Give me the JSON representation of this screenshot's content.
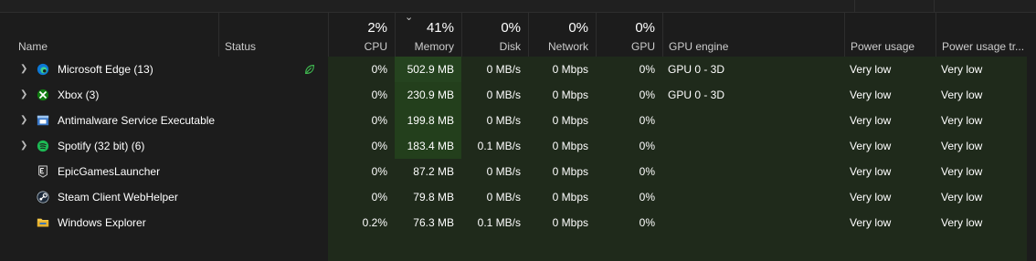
{
  "header": {
    "name_label": "Name",
    "status_label": "Status",
    "cpu": {
      "pct": "2%",
      "label": "CPU"
    },
    "memory": {
      "pct": "41%",
      "label": "Memory",
      "sort_indicator": "chevron-down"
    },
    "disk": {
      "pct": "0%",
      "label": "Disk"
    },
    "network": {
      "pct": "0%",
      "label": "Network"
    },
    "gpu": {
      "pct": "0%",
      "label": "GPU"
    },
    "gpu_engine_label": "GPU engine",
    "power_usage_label": "Power usage",
    "power_trend_label": "Power usage tr..."
  },
  "processes": [
    {
      "name": "Microsoft Edge (13)",
      "icon": "edge-icon",
      "expandable": true,
      "status_icon": "efficiency-leaf-icon",
      "cpu": "0%",
      "memory": "502.9 MB",
      "disk": "0 MB/s",
      "network": "0 Mbps",
      "gpu": "0%",
      "gpu_engine": "GPU 0 - 3D",
      "power": "Very low",
      "power_trend": "Very low"
    },
    {
      "name": "Xbox (3)",
      "icon": "xbox-icon",
      "expandable": true,
      "cpu": "0%",
      "memory": "230.9 MB",
      "disk": "0 MB/s",
      "network": "0 Mbps",
      "gpu": "0%",
      "gpu_engine": "GPU 0 - 3D",
      "power": "Very low",
      "power_trend": "Very low"
    },
    {
      "name": "Antimalware Service Executable",
      "icon": "antimalware-icon",
      "expandable": true,
      "cpu": "0%",
      "memory": "199.8 MB",
      "disk": "0 MB/s",
      "network": "0 Mbps",
      "gpu": "0%",
      "gpu_engine": "",
      "power": "Very low",
      "power_trend": "Very low"
    },
    {
      "name": "Spotify (32 bit) (6)",
      "icon": "spotify-icon",
      "expandable": true,
      "cpu": "0%",
      "memory": "183.4 MB",
      "disk": "0.1 MB/s",
      "network": "0 Mbps",
      "gpu": "0%",
      "gpu_engine": "",
      "power": "Very low",
      "power_trend": "Very low"
    },
    {
      "name": "EpicGamesLauncher",
      "icon": "epic-games-icon",
      "expandable": false,
      "cpu": "0%",
      "memory": "87.2 MB",
      "disk": "0 MB/s",
      "network": "0 Mbps",
      "gpu": "0%",
      "gpu_engine": "",
      "power": "Very low",
      "power_trend": "Very low"
    },
    {
      "name": "Steam Client WebHelper",
      "icon": "steam-icon",
      "expandable": false,
      "cpu": "0%",
      "memory": "79.8 MB",
      "disk": "0 MB/s",
      "network": "0 Mbps",
      "gpu": "0%",
      "gpu_engine": "",
      "power": "Very low",
      "power_trend": "Very low"
    },
    {
      "name": "Windows Explorer",
      "icon": "folder-icon",
      "expandable": false,
      "cpu": "0.2%",
      "memory": "76.3 MB",
      "disk": "0.1 MB/s",
      "network": "0 Mbps",
      "gpu": "0%",
      "gpu_engine": "",
      "power": "Very low",
      "power_trend": "Very low"
    }
  ],
  "colors": {
    "background": "#1c1c1c",
    "heat_low": "#1f2a1b",
    "heat_mid": "#233f1c",
    "heat_high": "#25431f",
    "efficiency_leaf": "#3fb950"
  }
}
